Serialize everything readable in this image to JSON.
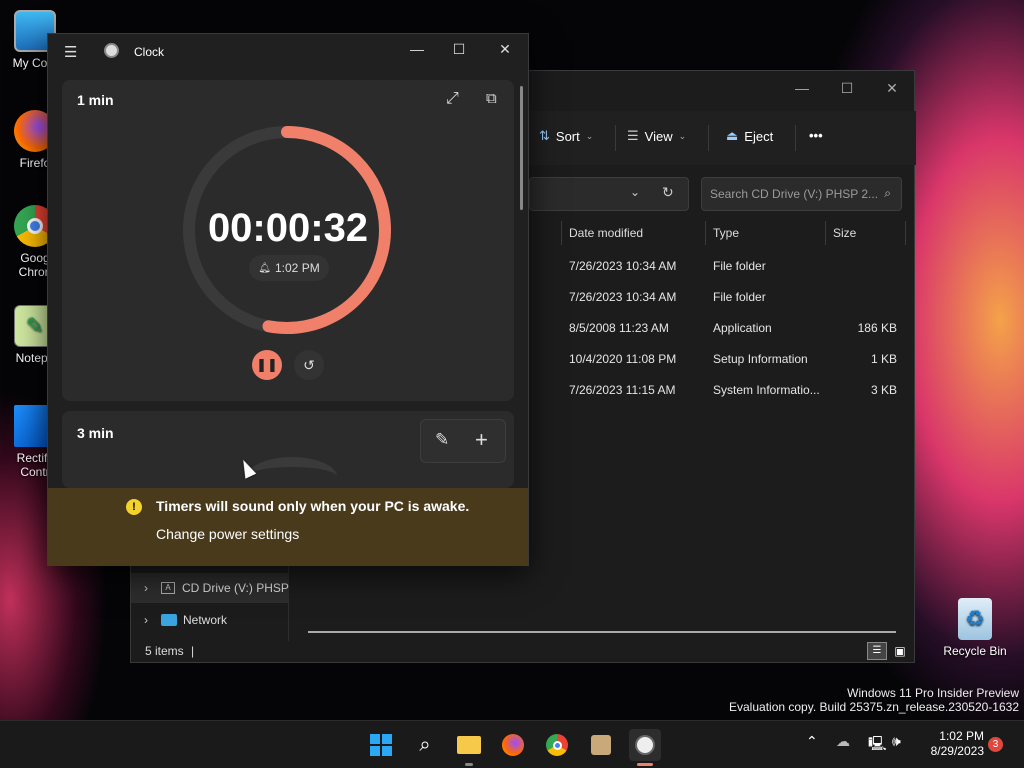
{
  "desktop": {
    "icons": [
      {
        "label": "My Com"
      },
      {
        "label": "Firefo"
      },
      {
        "label": "Goog Chron"
      },
      {
        "label": "Notepa"
      },
      {
        "label": "Rectify Contr"
      },
      {
        "label": "Recycle Bin"
      }
    ],
    "watermark_line1": "Windows 11 Pro Insider Preview",
    "watermark_line2": "Evaluation copy. Build 25375.zn_release.230520-1632"
  },
  "explorer": {
    "toolbar": {
      "sort": "Sort",
      "view": "View",
      "eject": "Eject",
      "more": "•••"
    },
    "search_placeholder": "Search CD Drive (V:) PHSP 2...",
    "columns": [
      "Date modified",
      "Type",
      "Size"
    ],
    "rows": [
      {
        "date": "7/26/2023 10:34 AM",
        "type": "File folder",
        "size": ""
      },
      {
        "date": "7/26/2023 10:34 AM",
        "type": "File folder",
        "size": ""
      },
      {
        "date": "8/5/2008 11:23 AM",
        "type": "Application",
        "size": "186 KB"
      },
      {
        "date": "10/4/2020 11:08 PM",
        "type": "Setup Information",
        "size": "1 KB"
      },
      {
        "date": "7/26/2023 11:15 AM",
        "type": "System Informatio...",
        "size": "3 KB"
      }
    ],
    "tree": [
      {
        "label": "CD Drive (V:) PHSP"
      },
      {
        "label": "Network"
      }
    ],
    "status": "5 items"
  },
  "clock": {
    "title": "Clock",
    "timer1": {
      "name": "1 min",
      "time": "00:00:32",
      "alarm": "1:02 PM",
      "progress": 0.53
    },
    "timer2": {
      "name": "3 min"
    },
    "banner": {
      "message": "Timers will sound only when your PC is awake.",
      "link": "Change power settings"
    },
    "colors": {
      "accent": "#f0806a",
      "banner": "#4a3a1c",
      "warning": "#f4d22c"
    }
  },
  "taskbar": {
    "time": "1:02 PM",
    "date": "8/29/2023",
    "notification_count": "3"
  }
}
